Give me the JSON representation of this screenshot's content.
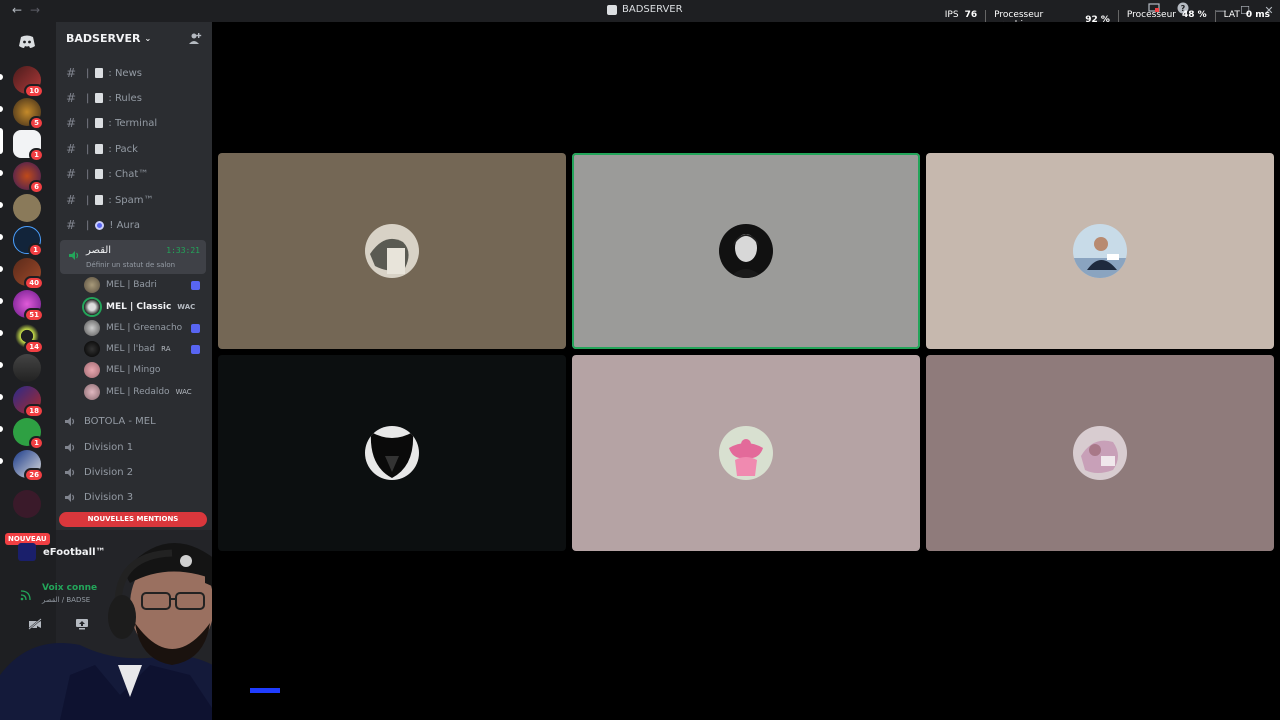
{
  "window": {
    "title": "BADSERVER"
  },
  "stats": {
    "ips_label": "IPS",
    "ips_value": "76",
    "gpu_label_1": "Processeur",
    "gpu_label_2": "graphique",
    "gpu_value": "92 %",
    "cpu_label": "Processeur",
    "cpu_value": "48 %",
    "lat_label": "LAT",
    "lat_value": "0 ms"
  },
  "rail": {
    "badges": [
      "10",
      "5",
      "1",
      "6",
      "1",
      "40",
      "51",
      "14",
      "18",
      "1",
      "26"
    ],
    "nouveau": "NOUVEAU"
  },
  "server": {
    "name": "BADSERVER"
  },
  "channels": [
    {
      "label": "News"
    },
    {
      "label": "Rules"
    },
    {
      "label": "Terminal"
    },
    {
      "label": "Pack"
    },
    {
      "label": "Chat™"
    },
    {
      "label": "Spam™"
    },
    {
      "label": "Aura"
    }
  ],
  "channel_prefix": ":",
  "active_voice": {
    "name": "القصر",
    "time": "1:33:21",
    "status": "Définir un statut de salon"
  },
  "members": [
    {
      "name": "MEL | Badri",
      "tag": ""
    },
    {
      "name": "MEL | Classic",
      "tag": "WAC"
    },
    {
      "name": "MEL | Greenacho",
      "tag": ""
    },
    {
      "name": "MEL | l'bad",
      "tag": "RA"
    },
    {
      "name": "MEL | Mingo",
      "tag": ""
    },
    {
      "name": "MEL | Redaldo",
      "tag": "WAC"
    }
  ],
  "voice_channels": [
    {
      "label": "BOTOLA - MEL"
    },
    {
      "label": "Division 1"
    },
    {
      "label": "Division 2"
    },
    {
      "label": "Division 3"
    }
  ],
  "mentions_label": "NOUVELLES MENTIONS",
  "activity": {
    "game": "eFootball™"
  },
  "voice_panel": {
    "connected": "Voix conne",
    "sub": "القصر / BADSE"
  },
  "colors": {
    "speaking": "#23a55a",
    "tile1": "#746755",
    "tile2": "#9b9b99",
    "tile3": "#c6b8ae",
    "tile4": "#0c0f10",
    "tile5": "#b5a3a4",
    "tile6": "#8f7b7b"
  }
}
